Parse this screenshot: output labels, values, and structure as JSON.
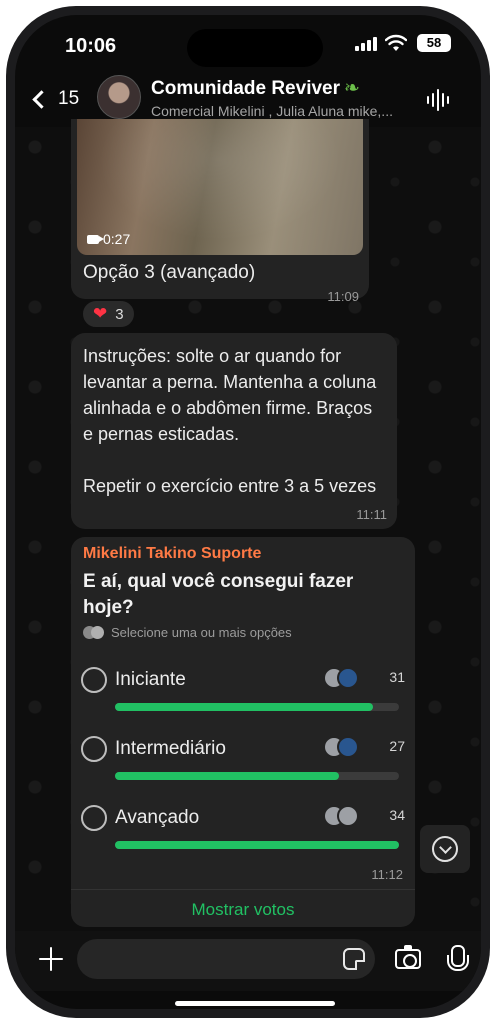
{
  "status_bar": {
    "time": "10:06",
    "battery": "58"
  },
  "header": {
    "back_count": "15",
    "title": "Comunidade Reviver",
    "subtitle": "Comercial Mikelini , Julia Aluna mike,..."
  },
  "messages": {
    "video": {
      "duration": "0:27",
      "caption": "Opção 3 (avançado)",
      "time": "11:09",
      "reaction_emoji": "❤",
      "reaction_count": "3"
    },
    "instructions": {
      "paragraph1": "Instruções: solte o ar quando for levantar a perna. Mantenha a coluna alinhada e o abdômen firme. Braços e pernas esticadas.",
      "paragraph2": "Repetir o exercício entre 3 a 5 vezes",
      "time": "11:11"
    },
    "poll": {
      "sender": "Mikelini Takino Suporte",
      "question": "E aí, qual você consegui fazer hoje?",
      "hint": "Selecione uma ou mais opções",
      "options": [
        {
          "label": "Iniciante",
          "votes": "31",
          "fill_fraction": 0.91
        },
        {
          "label": "Intermediário",
          "votes": "27",
          "fill_fraction": 0.79
        },
        {
          "label": "Avançado",
          "votes": "34",
          "fill_fraction": 1.0
        }
      ],
      "time": "11:12",
      "show_votes": "Mostrar votos"
    }
  },
  "colors": {
    "accent_green": "#21c063",
    "sender_orange": "#ff7a45",
    "bubble": "#232323",
    "background": "#0e0e0e"
  }
}
